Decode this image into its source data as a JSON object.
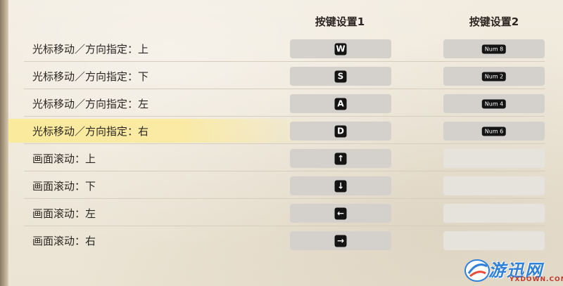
{
  "headers": {
    "col1": "按键设置1",
    "col2": "按键设置2"
  },
  "rows": [
    {
      "label": "光标移动／方向指定：上",
      "key1": "W",
      "key2": "Num 8",
      "highlight": false
    },
    {
      "label": "光标移动／方向指定：下",
      "key1": "S",
      "key2": "Num 2",
      "highlight": false
    },
    {
      "label": "光标移动／方向指定：左",
      "key1": "A",
      "key2": "Num 4",
      "highlight": false
    },
    {
      "label": "光标移动／方向指定：右",
      "key1": "D",
      "key2": "Num 6",
      "highlight": true
    },
    {
      "label": "画面滚动：上",
      "key1": "↑",
      "key2": "",
      "highlight": false
    },
    {
      "label": "画面滚动：下",
      "key1": "↓",
      "key2": "",
      "highlight": false
    },
    {
      "label": "画面滚动：左",
      "key1": "←",
      "key2": "",
      "highlight": false
    },
    {
      "label": "画面滚动：右",
      "key1": "→",
      "key2": "",
      "highlight": false
    }
  ],
  "watermark": {
    "text": "游迅网",
    "sub": "YXDOWN.COM"
  },
  "colors": {
    "highlight": "#fbea99",
    "keycap": "#141414",
    "slot": "#d4d1cc",
    "slot_empty": "#e6e3dd"
  }
}
